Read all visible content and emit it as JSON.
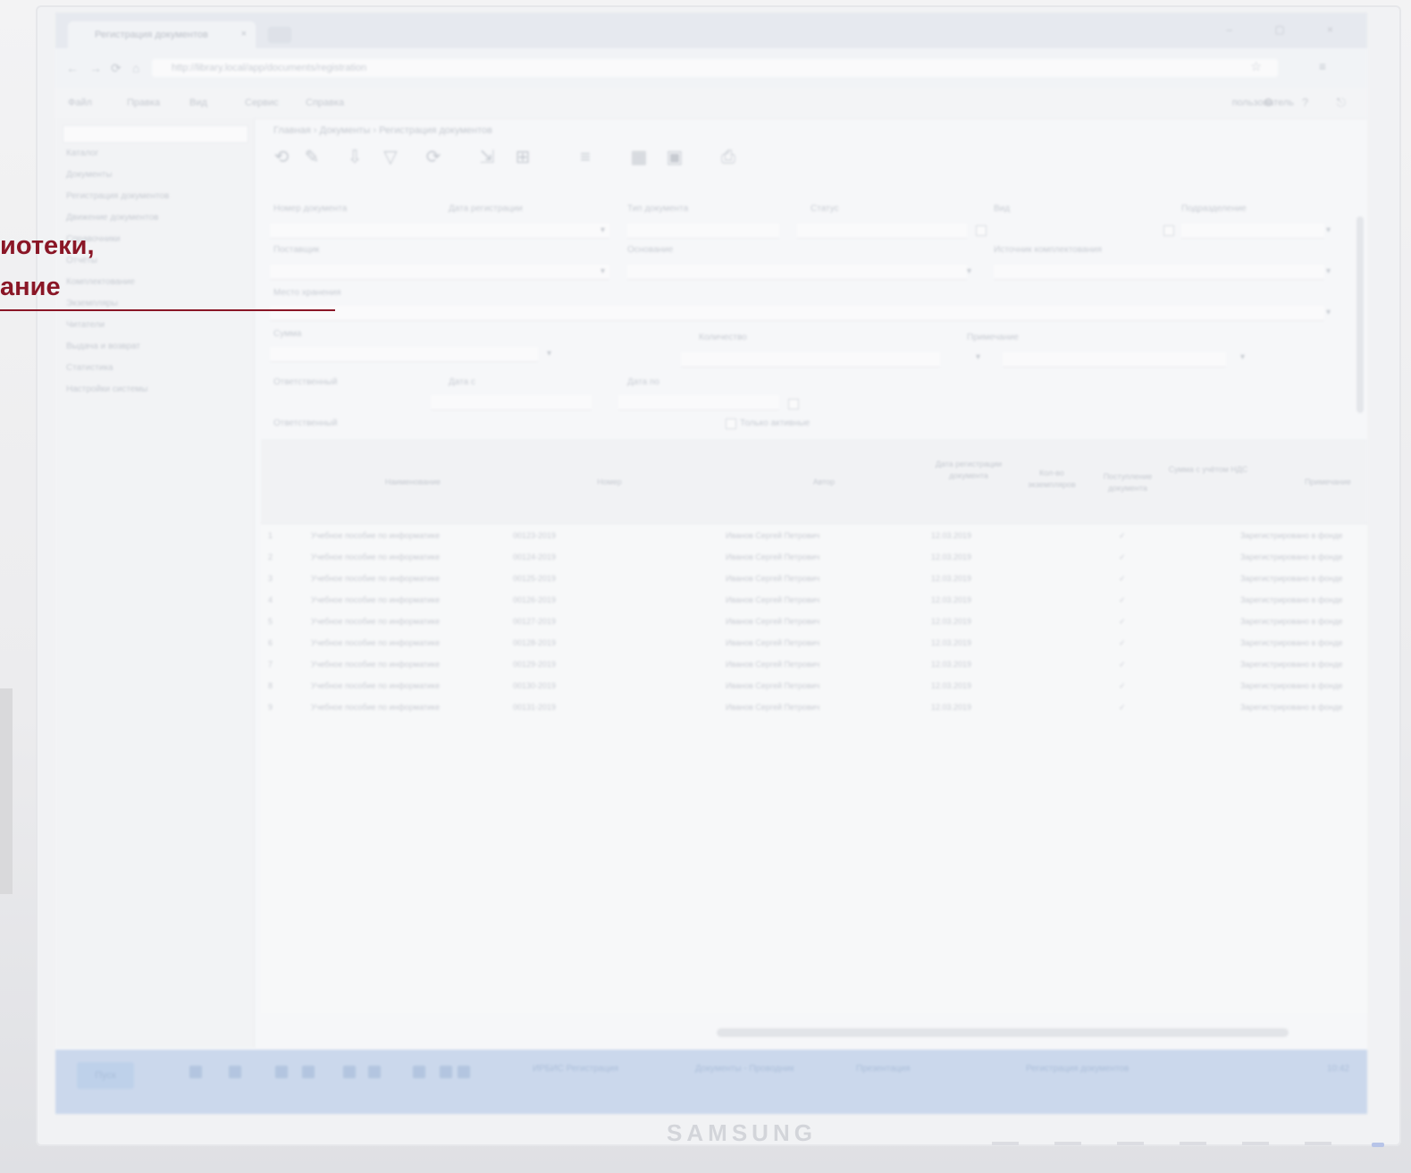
{
  "overlay": {
    "line1": "иотеки,",
    "line2": "ание"
  },
  "monitor": {
    "brand": "SAMSUNG"
  },
  "browser": {
    "tab_title": "Регистрация документов",
    "tab_close": "×",
    "new_tab": "+",
    "window_controls": "–  ▢  ×",
    "url": "http://library.local/app/documents/registration",
    "back": "←",
    "forward": "→",
    "reload": "⟳",
    "home": "⌂",
    "right_icons": "☆ ≡"
  },
  "app": {
    "menu": [
      "Файл",
      "Правка",
      "Вид",
      "Сервис",
      "Справка"
    ],
    "user": "пользователь",
    "menu_right": "⚙ ? ⎋",
    "sidebar_items": [
      "Каталог",
      "Документы",
      "Регистрация документов",
      "Движение документов",
      "Справочники",
      "Отчёты",
      "Комплектование",
      "Экземпляры",
      "Читатели",
      "Выдача и возврат",
      "Статистика",
      "Настройки системы"
    ],
    "breadcrumb": "Главная › Документы › Регистрация документов",
    "toolbar_icons": [
      "⟲",
      "✎",
      "⇩",
      "▽",
      "⟳",
      "⇲",
      "⊞",
      "≡",
      "▦",
      "▣",
      "⎙"
    ]
  },
  "form": {
    "f1": "Номер документа",
    "f2": "Дата регистрации",
    "f3": "Тип документа",
    "f4": "Статус",
    "f5": "Вид",
    "f6": "Подразделение",
    "f7": "Поставщик",
    "f8": "Основание",
    "f9": "Источник комплектования",
    "f10": "Место хранения",
    "f11": "Сумма",
    "f12": "Количество",
    "f13": "Примечание",
    "f14": "Ответственный",
    "f15": "Дата с",
    "f16": "Дата по",
    "f17": "Только активные",
    "dd": "▾"
  },
  "table": {
    "headers": [
      "Наименование",
      "Номер",
      "Автор",
      "Дата регистрации документа",
      "Кол-во экземпляров",
      "Поступление документа",
      "Сумма с учётом НДС",
      "Примечание"
    ],
    "rows": [
      {
        "n": "1",
        "name": "Учебное пособие по информатике",
        "num": "00123-2019",
        "author": "Иванов Сергей Петрович",
        "date": "12.03.2019",
        "mark": "✓",
        "note": "Зарегистрировано в фонде"
      },
      {
        "n": "2",
        "name": "Учебное пособие по информатике",
        "num": "00124-2019",
        "author": "Иванов Сергей Петрович",
        "date": "12.03.2019",
        "mark": "✓",
        "note": "Зарегистрировано в фонде"
      },
      {
        "n": "3",
        "name": "Учебное пособие по информатике",
        "num": "00125-2019",
        "author": "Иванов Сергей Петрович",
        "date": "12.03.2019",
        "mark": "✓",
        "note": "Зарегистрировано в фонде"
      },
      {
        "n": "4",
        "name": "Учебное пособие по информатике",
        "num": "00126-2019",
        "author": "Иванов Сергей Петрович",
        "date": "12.03.2019",
        "mark": "✓",
        "note": "Зарегистрировано в фонде"
      },
      {
        "n": "5",
        "name": "Учебное пособие по информатике",
        "num": "00127-2019",
        "author": "Иванов Сергей Петрович",
        "date": "12.03.2019",
        "mark": "✓",
        "note": "Зарегистрировано в фонде"
      },
      {
        "n": "6",
        "name": "Учебное пособие по информатике",
        "num": "00128-2019",
        "author": "Иванов Сергей Петрович",
        "date": "12.03.2019",
        "mark": "✓",
        "note": "Зарегистрировано в фонде"
      },
      {
        "n": "7",
        "name": "Учебное пособие по информатике",
        "num": "00129-2019",
        "author": "Иванов Сергей Петрович",
        "date": "12.03.2019",
        "mark": "✓",
        "note": "Зарегистрировано в фонде"
      },
      {
        "n": "8",
        "name": "Учебное пособие по информатике",
        "num": "00130-2019",
        "author": "Иванов Сергей Петрович",
        "date": "12.03.2019",
        "mark": "✓",
        "note": "Зарегистрировано в фонде"
      },
      {
        "n": "9",
        "name": "Учебное пособие по информатике",
        "num": "00131-2019",
        "author": "Иванов Сергей Петрович",
        "date": "12.03.2019",
        "mark": "✓",
        "note": "Зарегистрировано в фонде"
      }
    ]
  },
  "taskbar": {
    "start": "Пуск",
    "apps": [
      "ИРБИС Регистрация",
      "Документы - Проводник",
      "Презентация",
      "Регистрация документов"
    ],
    "clock": "10:42"
  }
}
